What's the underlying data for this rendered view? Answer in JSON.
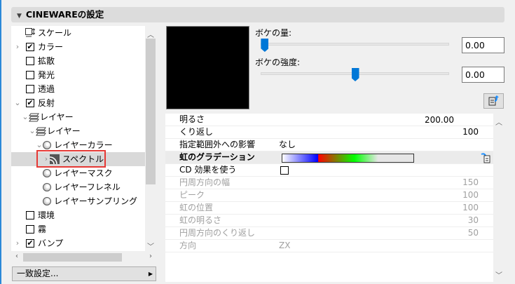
{
  "header": {
    "title": "CINEWAREの設定"
  },
  "tree": {
    "items": [
      {
        "label": "スケール",
        "level": 0,
        "expander": "",
        "check": null,
        "icon": "scale-icon"
      },
      {
        "label": "カラー",
        "level": 0,
        "expander": "›",
        "check": true
      },
      {
        "label": "拡散",
        "level": 0,
        "expander": "",
        "check": false
      },
      {
        "label": "発光",
        "level": 0,
        "expander": "",
        "check": false
      },
      {
        "label": "透過",
        "level": 0,
        "expander": "",
        "check": false
      },
      {
        "label": "反射",
        "level": 0,
        "expander": "⌄",
        "check": true
      },
      {
        "label": "レイヤー",
        "level": 1,
        "expander": "⌄",
        "icon": "layers-icon"
      },
      {
        "label": "レイヤー",
        "level": 2,
        "expander": "⌄",
        "icon": "layers-icon"
      },
      {
        "label": "レイヤーカラー",
        "level": 3,
        "expander": "⌄",
        "icon": "sphere-icon"
      },
      {
        "label": "スペクトル",
        "level": 4,
        "expander": "›",
        "icon": "spectral-icon",
        "selected": true
      },
      {
        "label": "レイヤーマスク",
        "level": 3,
        "expander": "",
        "icon": "sphere-icon"
      },
      {
        "label": "レイヤーフレネル",
        "level": 3,
        "expander": "",
        "icon": "sphere-icon"
      },
      {
        "label": "レイヤーサンプリング",
        "level": 3,
        "expander": "",
        "icon": "sphere-icon"
      },
      {
        "label": "環境",
        "level": 0,
        "expander": "",
        "check": false
      },
      {
        "label": "霧",
        "level": 0,
        "expander": "",
        "check": false
      },
      {
        "label": "バンプ",
        "level": 0,
        "expander": "›",
        "check": true
      }
    ]
  },
  "match_button": "一致設定...",
  "bokeh": {
    "amount_label": "ボケの量:",
    "amount_value": "0.00",
    "amount_slider": 0.02,
    "strength_label": "ボケの強度:",
    "strength_value": "0.00",
    "strength_slider": 0.5
  },
  "props": [
    {
      "label": "明るさ",
      "input": "200.00",
      "state": "selected"
    },
    {
      "label": "くり返し",
      "right": "100"
    },
    {
      "label": "指定範囲外への影響",
      "value": "なし"
    },
    {
      "label": "虹のグラデーション",
      "gradient": true,
      "state": "band"
    },
    {
      "label": "CD 効果を使う",
      "checkbox": false
    },
    {
      "label": "円周方向の幅",
      "right": "150",
      "state": "grey"
    },
    {
      "label": "ピーク",
      "right": "100",
      "state": "grey"
    },
    {
      "label": "虹の位置",
      "right": "100",
      "state": "grey"
    },
    {
      "label": "虹の明るさ",
      "right": "30",
      "state": "grey"
    },
    {
      "label": "円周方向のくり返し",
      "right": "50",
      "state": "grey"
    },
    {
      "label": "方向",
      "value": "ZX",
      "state": "grey"
    }
  ],
  "colors": {
    "accent": "#0078d7",
    "selection": "#3399ff",
    "highlight_border": "#e53935"
  }
}
